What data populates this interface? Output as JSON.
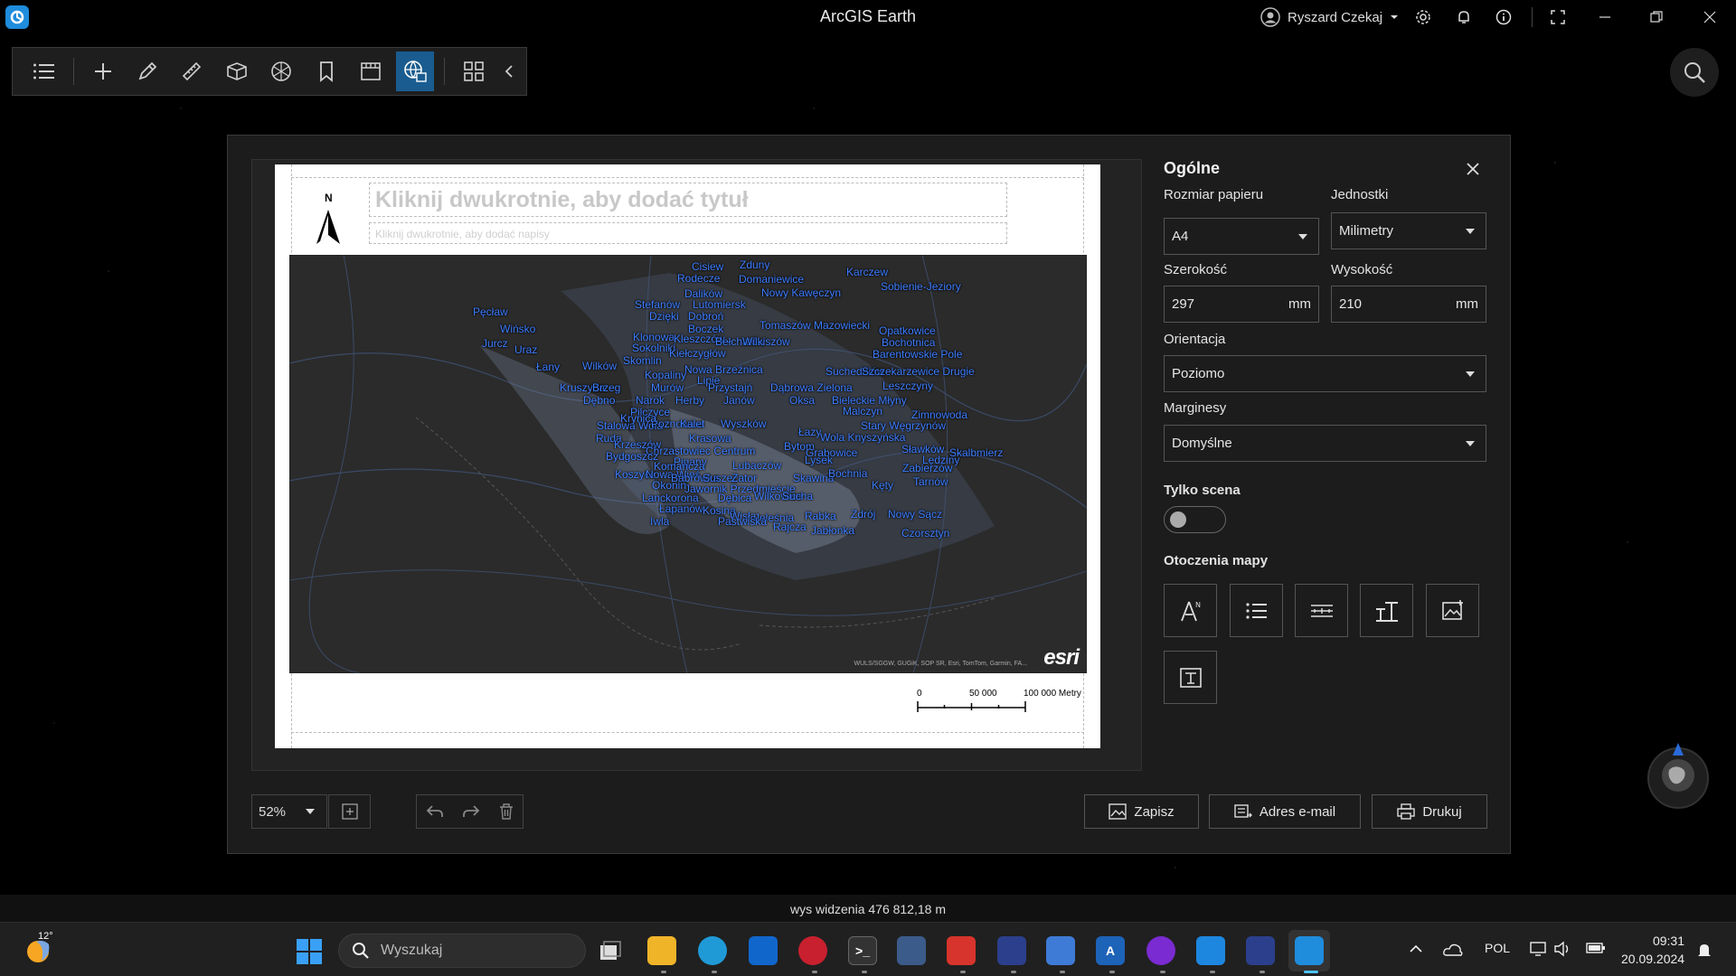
{
  "window": {
    "title": "ArcGIS Earth",
    "user": "Ryszard Czekaj"
  },
  "toolbar": {
    "tools": [
      "contents-icon",
      "add-icon",
      "draw-icon",
      "measure-icon",
      "3d-object-icon",
      "analysis-icon",
      "bookmark-icon",
      "presentation-icon",
      "print-icon",
      "apps-icon",
      "collapse-icon"
    ]
  },
  "layout": {
    "title_placeholder": "Kliknij dwukrotnie, aby dodać tytuł",
    "subtitle_placeholder": "Kliknij dwukrotnie, aby dodać napisy",
    "north_label": "N",
    "attribution": "WULS/SGGW, GUGiK, SOP SR, Esri, TomTom, Garmin, FA...",
    "esri_logo": "esri",
    "scale": {
      "tick0": "0",
      "tick1": "50 000",
      "tick2": "100 000 Metry"
    },
    "map_labels": [
      "Cisiew",
      "Zduny",
      "Rodecze",
      "Domaniewice",
      "Karczew",
      "Sobienie-Jeziory",
      "Dalików",
      "Nowy Kawęczyn",
      "Stefanów",
      "Lutomiersk",
      "Pęcław",
      "Dzięki",
      "Dobroń",
      "Wińsko",
      "Tomaszów Mazowiecki",
      "Opatkowice",
      "Boczek",
      "Bochotnica",
      "Jurcz",
      "Klonowa",
      "Kleszczów",
      "Bełchatów",
      "Wilkiszów",
      "Uraz",
      "Sokolniki",
      "Barentowskie Pole",
      "Kiełczygłów",
      "Skomlin",
      "Łany",
      "Wilków",
      "Nowa Brzeźnica",
      "Suchedniów",
      "Szczekarzewice Drugie",
      "Kopaliny",
      "Lipie",
      "Kruszyna",
      "Brzeg",
      "Murów",
      "Przystajń",
      "Dąbrowa Zielona",
      "Leszczyny",
      "Dębno",
      "Narok",
      "Herby",
      "Janów",
      "Oksa",
      "Bieleckie Młyny",
      "Pilczyce",
      "Malczyn",
      "Zimnowoda",
      "Stalowa Wola",
      "Poznowice",
      "Kalet",
      "Wyszków",
      "Stary Węgrzynów",
      "Ruda",
      "Krasowa",
      "Łazy",
      "Wola Knyszyńska",
      "Krzeszów",
      "Chrzastowiec Centrum",
      "Bytom",
      "Grabowice",
      "Sławków",
      "Skalbmierz",
      "Bydgoszcz",
      "Pigany",
      "Lubaczów",
      "Lysek",
      "Lędziny",
      "Zabierzów",
      "Koszyce",
      "Nowa Wieś",
      "Babrówka",
      "Suszec",
      "Zator",
      "Skawina",
      "Bochnia",
      "Tarnów",
      "Okonin",
      "Jawornik Przedmieście",
      "Kęty",
      "Lanckorona",
      "Dębica",
      "Wilkowice",
      "Sucha",
      "Łapanów",
      "Kosina",
      "Wisła",
      "Jeleśnia",
      "Rabka",
      "Zdrój",
      "Nowy Sącz",
      "Iwla",
      "Pastwiska",
      "Rajcza",
      "Jabłonka",
      "Czorsztyn",
      "Krynica",
      "Komańcza"
    ]
  },
  "panel": {
    "title": "Ogólne",
    "paper_size_label": "Rozmiar papieru",
    "paper_size_value": "A4",
    "units_label": "Jednostki",
    "units_value": "Milimetry",
    "width_label": "Szerokość",
    "width_value": "297",
    "height_label": "Wysokość",
    "height_value": "210",
    "unit_mm": "mm",
    "orientation_label": "Orientacja",
    "orientation_value": "Poziomo",
    "margins_label": "Marginesy",
    "margins_value": "Domyślne",
    "scene_only_label": "Tylko scena",
    "scene_only": false,
    "surrounds_label": "Otoczenia mapy",
    "surrounds": [
      "north-arrow-icon",
      "legend-icon",
      "scale-bar-icon",
      "text-icon",
      "image-icon",
      "text-box-icon"
    ]
  },
  "controls": {
    "zoom": "52%",
    "save": "Zapisz",
    "email": "Adres e-mail",
    "print": "Drukuj"
  },
  "status": {
    "view_height": "wys widzenia 476 812,18 m"
  },
  "taskbar": {
    "temperature": "12°",
    "search_placeholder": "Wyszukaj",
    "language": "POL",
    "time": "09:31",
    "date": "20.09.2024"
  },
  "colors": {
    "accent": "#1a5c8f",
    "map_label": "#3d7dff",
    "map_background": "#2c2c2c"
  }
}
